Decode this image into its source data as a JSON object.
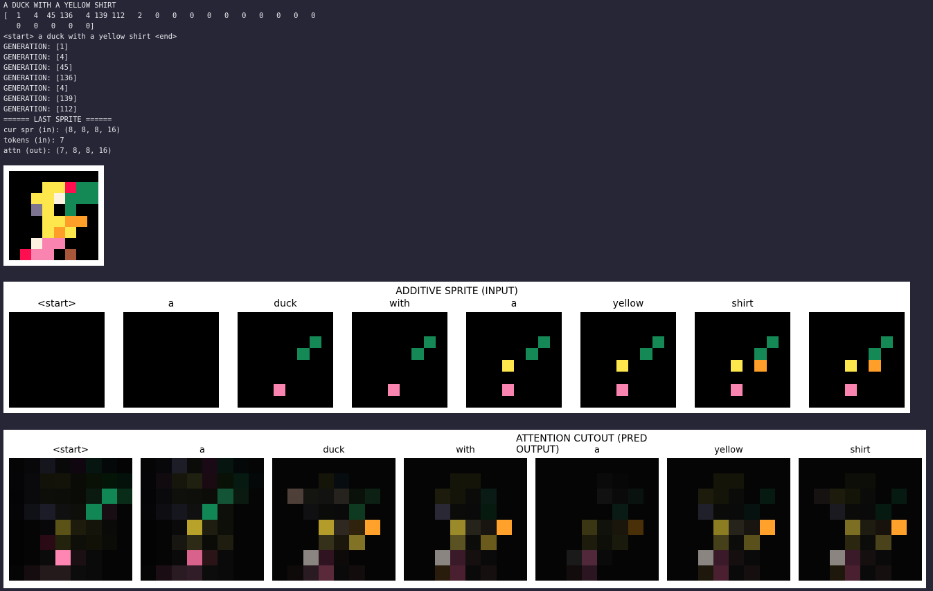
{
  "console": {
    "lines": [
      "A DUCK WITH A YELLOW SHIRT",
      "[  1   4  45 136   4 139 112   2   0   0   0   0   0   0   0   0   0   0",
      "   0   0   0   0   0]",
      "<start> a duck with a yellow shirt <end>",
      "GENERATION: [1]",
      "GENERATION: [4]",
      "GENERATION: [45]",
      "GENERATION: [136]",
      "GENERATION: [4]",
      "GENERATION: [139]",
      "GENERATION: [112]",
      "====== LAST SPRITE ======",
      "cur spr (in): (8, 8, 8, 16)",
      "tokens (in): 7",
      "attn (out): (7, 8, 8, 16)"
    ]
  },
  "final_sprite": {
    "rows": [
      "........",
      "...YYRGG",
      "..YYWGGG",
      "..PY.G..",
      "...YYOO.",
      "...YOY..",
      "..WKK...",
      ".RKK.B.."
    ]
  },
  "additive": {
    "title": "ADDITIVE SPRITE (INPUT)",
    "captions": [
      "<start>",
      "a",
      "duck",
      "with",
      "a",
      "yellow",
      "shirt",
      ""
    ],
    "frames": [
      [
        "........",
        "........",
        "........",
        "........",
        "........",
        "........",
        "........",
        "........"
      ],
      [
        "........",
        "........",
        "........",
        "........",
        "........",
        "........",
        "........",
        "........"
      ],
      [
        "........",
        "........",
        "......G.",
        ".....G..",
        "........",
        "........",
        "...K....",
        "........"
      ],
      [
        "........",
        "........",
        "......G.",
        ".....G..",
        "........",
        "........",
        "...K....",
        "........"
      ],
      [
        "........",
        "........",
        "......G.",
        ".....G..",
        "...Y....",
        "........",
        "...K....",
        "........"
      ],
      [
        "........",
        "........",
        "......G.",
        ".....G..",
        "...Y....",
        "........",
        "...K....",
        "........"
      ],
      [
        "........",
        "........",
        "......G.",
        ".....G..",
        "...Y.O..",
        "........",
        "...K....",
        "........"
      ],
      [
        "........",
        "........",
        "......G.",
        ".....G..",
        "...Y.O..",
        "........",
        "...K....",
        "........"
      ]
    ]
  },
  "attention": {
    "title": "ATTENTION CUTOUT (PRED OUTPUT)",
    "captions": [
      "<start>",
      "a",
      "duck",
      "with",
      "a",
      "yellow",
      "shirt"
    ],
    "frames": [
      [
        [
          "#050506",
          "#08080b",
          "#15151d",
          "#09090a",
          "#100610",
          "#061510",
          "#040808",
          "#040405"
        ],
        [
          "#050507",
          "#0a0a0d",
          "#121209",
          "#141309",
          "#0a0a07",
          "#091006",
          "#041407",
          "#04110a"
        ],
        [
          "#040406",
          "#0a0a0c",
          "#0d0d0a",
          "#0c0c08",
          "#0a0a07",
          "#0b1a10",
          "#128756",
          "#082c18"
        ],
        [
          "#050507",
          "#101017",
          "#1c1c28",
          "#101010",
          "#0e0e0b",
          "#128756",
          "#170d13",
          "#050506"
        ],
        [
          "#030303",
          "#050505",
          "#08080a",
          "#5a5217",
          "#1c1b0c",
          "#15140b",
          "#0a0a08",
          "#050505"
        ],
        [
          "#030303",
          "#050505",
          "#2a0a14",
          "#23220d",
          "#0f0f0a",
          "#111108",
          "#0b0b08",
          "#050505"
        ],
        [
          "#030303",
          "#050505",
          "#0b0b0b",
          "#ff85b2",
          "#1a0f12",
          "#0a0a0a",
          "#050505",
          "#050505"
        ],
        [
          "#050505",
          "#150c10",
          "#241a1c",
          "#24191b",
          "#0c0c0c",
          "#0a0a0a",
          "#050505",
          "#050505"
        ]
      ],
      [
        [
          "#050506",
          "#08080b",
          "#1d1d28",
          "#0b0b0a",
          "#1a0a16",
          "#061510",
          "#040808",
          "#050505"
        ],
        [
          "#050507",
          "#110b10",
          "#16160c",
          "#202010",
          "#1a0a12",
          "#091006",
          "#061a12",
          "#040808"
        ],
        [
          "#040406",
          "#0a0a0c",
          "#0f0f0b",
          "#0e0e0a",
          "#0c0c08",
          "#135437",
          "#0a1a10",
          "#050505"
        ],
        [
          "#050507",
          "#0d0d12",
          "#16161e",
          "#101010",
          "#128756",
          "#0e0e0b",
          "#050506",
          "#050505"
        ],
        [
          "#030303",
          "#050505",
          "#0a0a0a",
          "#b8a22a",
          "#1e1d10",
          "#0f0f0a",
          "#050505",
          "#050505"
        ],
        [
          "#030303",
          "#050505",
          "#171610",
          "#2d2b16",
          "#0b0b08",
          "#1f1d10",
          "#050505",
          "#050505"
        ],
        [
          "#030303",
          "#050505",
          "#0a0a0a",
          "#d9628c",
          "#2a1418",
          "#0a0a0a",
          "#050505",
          "#050505"
        ],
        [
          "#050505",
          "#1a0e14",
          "#2a1a22",
          "#311d27",
          "#0c0c0c",
          "#0a0a0a",
          "#050505",
          "#050505"
        ]
      ],
      [
        [
          "#050505",
          "#050505",
          "#050505",
          "#050505",
          "#050505",
          "#050505",
          "#050505",
          "#050505"
        ],
        [
          "#050505",
          "#050505",
          "#050505",
          "#151409",
          "#060c10",
          "#050505",
          "#050505",
          "#050505"
        ],
        [
          "#050505",
          "#4e3f38",
          "#141410",
          "#121210",
          "#26231f",
          "#0a100a",
          "#0c2014",
          "#050505"
        ],
        [
          "#050505",
          "#050505",
          "#101012",
          "#0b0b09",
          "#0a0a0a",
          "#0e3a22",
          "#050505",
          "#050505"
        ],
        [
          "#050505",
          "#050505",
          "#050505",
          "#b49c2a",
          "#2f2821",
          "#30230d",
          "#ffa12a",
          "#050505"
        ],
        [
          "#050505",
          "#050505",
          "#050505",
          "#35301a",
          "#1c170d",
          "#827226",
          "#050505",
          "#050505"
        ],
        [
          "#050505",
          "#050505",
          "#8a8580",
          "#2f1320",
          "#0f0a0a",
          "#050505",
          "#050505",
          "#050505"
        ],
        [
          "#050505",
          "#0f0a0a",
          "#2a1a22",
          "#5a2a3a",
          "#0a0a0a",
          "#120c0c",
          "#050505",
          "#050505"
        ]
      ],
      [
        [
          "#050505",
          "#050505",
          "#050505",
          "#050505",
          "#050505",
          "#050505",
          "#050505",
          "#050505"
        ],
        [
          "#050505",
          "#050505",
          "#050505",
          "#151409",
          "#151409",
          "#050505",
          "#050505",
          "#050505"
        ],
        [
          "#050505",
          "#050505",
          "#1c1b0c",
          "#151409",
          "#0b0b09",
          "#0a1a14",
          "#050505",
          "#050505"
        ],
        [
          "#050505",
          "#050505",
          "#2a2835",
          "#0b0b09",
          "#0a0a0a",
          "#061a10",
          "#050505",
          "#050505"
        ],
        [
          "#050505",
          "#050505",
          "#050505",
          "#9a8a2a",
          "#26231a",
          "#181410",
          "#ffa12a",
          "#050505"
        ],
        [
          "#050505",
          "#050505",
          "#050505",
          "#5a5222",
          "#0c0c0a",
          "#6a5a1c",
          "#050505",
          "#050505"
        ],
        [
          "#050505",
          "#050505",
          "#8a8580",
          "#3a1a28",
          "#160f0f",
          "#0a0a0a",
          "#050505",
          "#050505"
        ],
        [
          "#050505",
          "#050505",
          "#2a1c0c",
          "#4a2030",
          "#0a0a0a",
          "#160f0f",
          "#050505",
          "#050505"
        ]
      ],
      [
        [
          "#050505",
          "#050505",
          "#050505",
          "#050505",
          "#050505",
          "#050505",
          "#050505",
          "#050505"
        ],
        [
          "#050505",
          "#050505",
          "#050505",
          "#050505",
          "#0a0a0a",
          "#070707",
          "#050505",
          "#050505"
        ],
        [
          "#050505",
          "#050505",
          "#050505",
          "#050505",
          "#111111",
          "#0a0a0a",
          "#0a1210",
          "#050505"
        ],
        [
          "#050505",
          "#050505",
          "#050505",
          "#050505",
          "#050505",
          "#0a1a14",
          "#050505",
          "#050505"
        ],
        [
          "#050505",
          "#050505",
          "#050505",
          "#3a3614",
          "#12120c",
          "#1a160c",
          "#4a3008",
          "#050505"
        ],
        [
          "#050505",
          "#050505",
          "#050505",
          "#1c1b0c",
          "#0f0f0a",
          "#1a1a0c",
          "#050505",
          "#050505"
        ],
        [
          "#050505",
          "#050505",
          "#1a1a1a",
          "#50283a",
          "#0a0a0a",
          "#050505",
          "#050505",
          "#050505"
        ],
        [
          "#050505",
          "#050505",
          "#120c0c",
          "#2a1520",
          "#050505",
          "#050505",
          "#050505",
          "#050505"
        ]
      ],
      [
        [
          "#050505",
          "#050505",
          "#050505",
          "#050505",
          "#050505",
          "#050505",
          "#050505",
          "#050505"
        ],
        [
          "#050505",
          "#050505",
          "#050505",
          "#141409",
          "#141409",
          "#050505",
          "#050505",
          "#050505"
        ],
        [
          "#050505",
          "#050505",
          "#1c1b0c",
          "#151409",
          "#0b0b09",
          "#050505",
          "#061a12",
          "#050505"
        ],
        [
          "#050505",
          "#050505",
          "#20202a",
          "#0b0b09",
          "#0a0a0a",
          "#061210",
          "#050505",
          "#050505"
        ],
        [
          "#050505",
          "#050505",
          "#050505",
          "#8c7c22",
          "#26231a",
          "#181410",
          "#ffa12a",
          "#050505"
        ],
        [
          "#050505",
          "#050505",
          "#050505",
          "#46401a",
          "#0c0c0a",
          "#5a501c",
          "#050505",
          "#050505"
        ],
        [
          "#050505",
          "#050505",
          "#8a8580",
          "#3a1a28",
          "#160f0f",
          "#0a0a0a",
          "#050505",
          "#050505"
        ],
        [
          "#050505",
          "#050505",
          "#1e180c",
          "#4a2030",
          "#0a0a0a",
          "#160f0f",
          "#050505",
          "#050505"
        ]
      ],
      [
        [
          "#050505",
          "#050505",
          "#050505",
          "#050505",
          "#050505",
          "#050505",
          "#050505",
          "#050505"
        ],
        [
          "#050505",
          "#050505",
          "#050505",
          "#0e0e08",
          "#0e0e08",
          "#050505",
          "#050505",
          "#050505"
        ],
        [
          "#050505",
          "#151211",
          "#1c1b0c",
          "#151409",
          "#0b0b09",
          "#050505",
          "#061a12",
          "#050505"
        ],
        [
          "#050505",
          "#050505",
          "#1a1a20",
          "#0b0b09",
          "#0a0a0a",
          "#061a12",
          "#050505",
          "#050505"
        ],
        [
          "#050505",
          "#050505",
          "#050505",
          "#7c6e22",
          "#1e1c10",
          "#18120c",
          "#ffa12a",
          "#050505"
        ],
        [
          "#050505",
          "#050505",
          "#050505",
          "#2a2610",
          "#0c0c0a",
          "#4a421a",
          "#050505",
          "#050505"
        ],
        [
          "#050505",
          "#050505",
          "#8a8580",
          "#3a1a28",
          "#160f0f",
          "#0a0a0a",
          "#050505",
          "#050505"
        ],
        [
          "#050505",
          "#050505",
          "#1e180c",
          "#4a2030",
          "#0a0a0a",
          "#160f0f",
          "#050505",
          "#050505"
        ]
      ]
    ]
  },
  "palette": {
    "K": "#f984b0",
    "G": "#148956",
    "Y": "#fde74c",
    "O": "#ff9f2a",
    "R": "#ff0f50",
    "W": "#fdf1df",
    "P": "#7c7490",
    "B": "#a8563a",
    ".": "#000000"
  }
}
